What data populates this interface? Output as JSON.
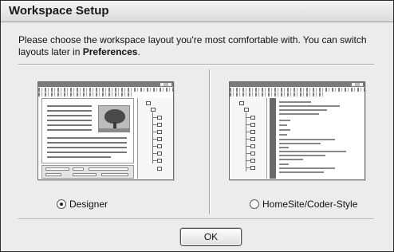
{
  "window": {
    "title": "Workspace Setup"
  },
  "instructions": {
    "text_before": "Please choose the workspace layout you're most comfortable with. You can switch layouts later in ",
    "bold": "Preferences",
    "text_after": "."
  },
  "options": [
    {
      "label": "Designer",
      "selected": true,
      "preview_icon": "designer-layout-preview"
    },
    {
      "label": "HomeSite/Coder-Style",
      "selected": false,
      "preview_icon": "coder-layout-preview"
    }
  ],
  "buttons": {
    "ok_label": "OK"
  }
}
